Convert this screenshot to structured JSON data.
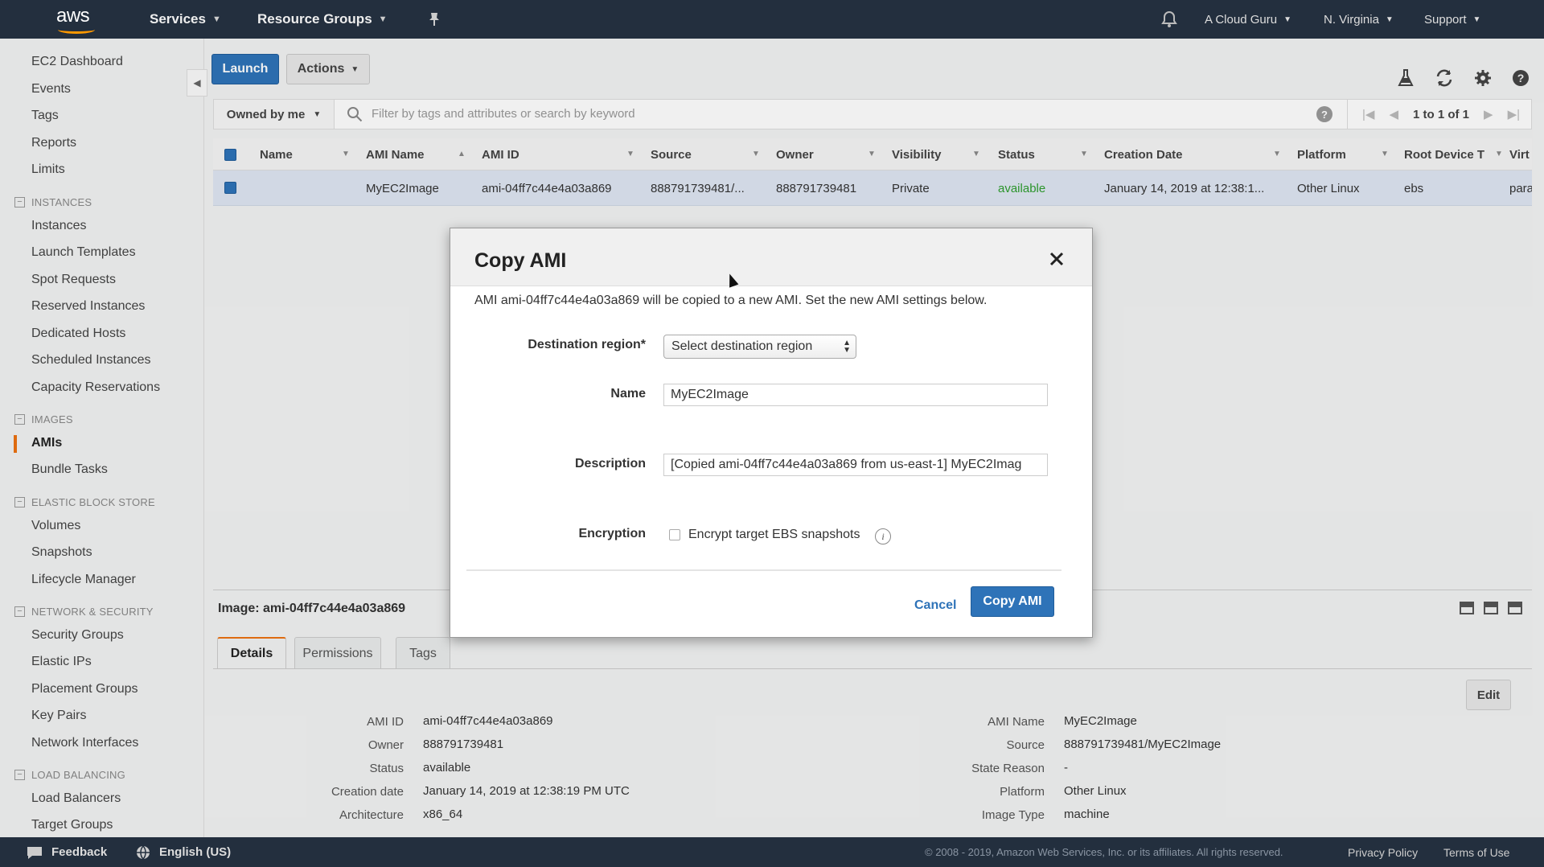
{
  "topnav": {
    "logo": "aws",
    "services": "Services",
    "resource_groups": "Resource Groups",
    "account": "A Cloud Guru",
    "region": "N. Virginia",
    "support": "Support"
  },
  "sidebar": {
    "top_links": [
      "EC2 Dashboard",
      "Events",
      "Tags",
      "Reports",
      "Limits"
    ],
    "instances_header": "INSTANCES",
    "instances": [
      "Instances",
      "Launch Templates",
      "Spot Requests",
      "Reserved Instances",
      "Dedicated Hosts",
      "Scheduled Instances",
      "Capacity Reservations"
    ],
    "images_header": "IMAGES",
    "images": [
      "AMIs",
      "Bundle Tasks"
    ],
    "ebs_header": "ELASTIC BLOCK STORE",
    "ebs": [
      "Volumes",
      "Snapshots",
      "Lifecycle Manager"
    ],
    "network_header": "NETWORK & SECURITY",
    "network": [
      "Security Groups",
      "Elastic IPs",
      "Placement Groups",
      "Key Pairs",
      "Network Interfaces"
    ],
    "lb_header": "LOAD BALANCING",
    "lb": [
      "Load Balancers",
      "Target Groups"
    ]
  },
  "toolbar": {
    "launch": "Launch",
    "actions": "Actions"
  },
  "filter": {
    "owned": "Owned by me",
    "search_placeholder": "Filter by tags and attributes or search by keyword",
    "pager": "1 to 1 of 1"
  },
  "table": {
    "headers": [
      "Name",
      "AMI Name",
      "AMI ID",
      "Source",
      "Owner",
      "Visibility",
      "Status",
      "Creation Date",
      "Platform",
      "Root Device T",
      "Virt"
    ],
    "row": {
      "name": "",
      "ami_name": "MyEC2Image",
      "ami_id": "ami-04ff7c44e4a03a869",
      "source": "888791739481/...",
      "owner": "888791739481",
      "visibility": "Private",
      "status": "available",
      "creation_date": "January 14, 2019 at 12:38:1...",
      "platform": "Other Linux",
      "root_device": "ebs",
      "virt": "para"
    }
  },
  "details": {
    "title": "Image: ami-04ff7c44e4a03a869",
    "tabs": [
      "Details",
      "Permissions",
      "Tags"
    ],
    "edit": "Edit",
    "left": [
      {
        "label": "AMI ID",
        "value": "ami-04ff7c44e4a03a869"
      },
      {
        "label": "Owner",
        "value": "888791739481"
      },
      {
        "label": "Status",
        "value": "available"
      },
      {
        "label": "Creation date",
        "value": "January 14, 2019 at 12:38:19 PM UTC"
      },
      {
        "label": "Architecture",
        "value": "x86_64"
      }
    ],
    "right": [
      {
        "label": "AMI Name",
        "value": "MyEC2Image"
      },
      {
        "label": "Source",
        "value": "888791739481/MyEC2Image"
      },
      {
        "label": "State Reason",
        "value": "-"
      },
      {
        "label": "Platform",
        "value": "Other Linux"
      },
      {
        "label": "Image Type",
        "value": "machine"
      }
    ]
  },
  "modal": {
    "title": "Copy AMI",
    "intro": "AMI ami-04ff7c44e4a03a869 will be copied to a new AMI. Set the new AMI settings below.",
    "dest_label": "Destination region*",
    "dest_value": "Select destination region",
    "name_label": "Name",
    "name_value": "MyEC2Image",
    "desc_label": "Description",
    "desc_value": "[Copied ami-04ff7c44e4a03a869 from us-east-1] MyEC2Imag",
    "enc_label": "Encryption",
    "enc_checkbox": "Encrypt target EBS snapshots",
    "cancel": "Cancel",
    "submit": "Copy AMI"
  },
  "footer": {
    "feedback": "Feedback",
    "language": "English (US)",
    "copyright": "© 2008 - 2019, Amazon Web Services, Inc. or its affiliates. All rights reserved.",
    "privacy": "Privacy Policy",
    "terms": "Terms of Use"
  },
  "colors": {
    "nav_bg": "#232f3e",
    "primary": "#2e73b8",
    "accent": "#ec7211",
    "available": "#2e9e2e",
    "selected_row": "#dfe6f3"
  }
}
